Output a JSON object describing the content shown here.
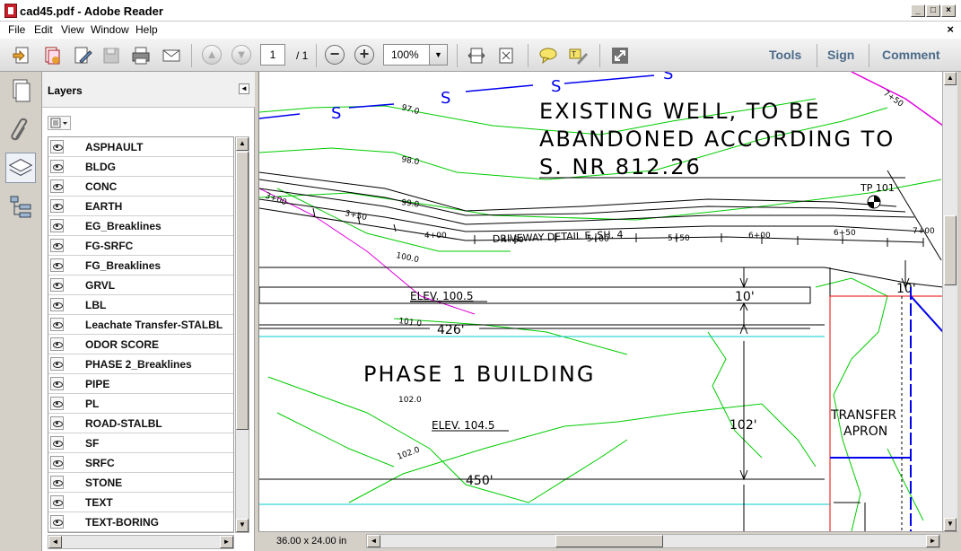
{
  "window": {
    "title": "cad45.pdf - Adobe Reader",
    "caption_buttons": [
      "_",
      "□",
      "×"
    ]
  },
  "menubar": {
    "items": [
      "File",
      "Edit",
      "View",
      "Window",
      "Help"
    ],
    "close_glyph": "×"
  },
  "toolbar": {
    "page_current": "1",
    "page_total": "/ 1",
    "zoom": "100%",
    "zoom_out_glyph": "−",
    "zoom_in_glyph": "+",
    "links": [
      "Tools",
      "Sign",
      "Comment"
    ],
    "link_color": "#4b6b8a"
  },
  "navigation": {
    "buttons": [
      "pages-icon",
      "attachments-icon",
      "layers-icon",
      "model-tree-icon"
    ],
    "active": "layers-icon"
  },
  "layers_panel": {
    "title": "Layers",
    "layers": [
      "ASPHAULT",
      "BLDG",
      "CONC",
      "EARTH",
      "EG_Breaklines",
      "FG-SRFC",
      "FG_Breaklines",
      "GRVL",
      "LBL",
      "Leachate Transfer-STALBL",
      "ODOR SCORE",
      "PHASE 2_Breaklines",
      "PIPE",
      "PL",
      "ROAD-STALBL",
      "SF",
      "SRFC",
      "STONE",
      "TEXT",
      "TEXT-BORING"
    ]
  },
  "drawing": {
    "note_lines": [
      "EXISTING WELL, TO BE",
      "ABANDONED ACCORDING TO",
      "S. NR 812.26"
    ],
    "building_label": "PHASE 1 BUILDING",
    "elev_upper": "ELEV. 100.5",
    "elev_lower": "ELEV. 104.5",
    "transfer_apron": [
      "TRANSFER",
      "APRON"
    ],
    "driveway_label": "DRIVEWAY DETAIL E, SH. 4",
    "tp_label": "TP 101",
    "dims": {
      "d10_left": "10'",
      "d10_right": "10'",
      "d426": "426'",
      "d102": "102'",
      "d450": "450'"
    },
    "contours": [
      "97.0",
      "98.0",
      "99.0",
      "100.0",
      "101.0",
      "102.0",
      "102.0"
    ],
    "stations": [
      "3+00",
      "3+50",
      "4+00",
      "4+50",
      "5+00",
      "5+50",
      "6+00",
      "6+50",
      "7+00",
      "7+50"
    ],
    "sewer_letter": "S",
    "colors": {
      "contour": "#00cc00",
      "sewer": "#0000ee",
      "magenta": "#dd00dd",
      "cyan": "#00cccc",
      "red": "#ee0000"
    }
  },
  "statusbar": {
    "page_size": "36.00 x 24.00 in"
  }
}
